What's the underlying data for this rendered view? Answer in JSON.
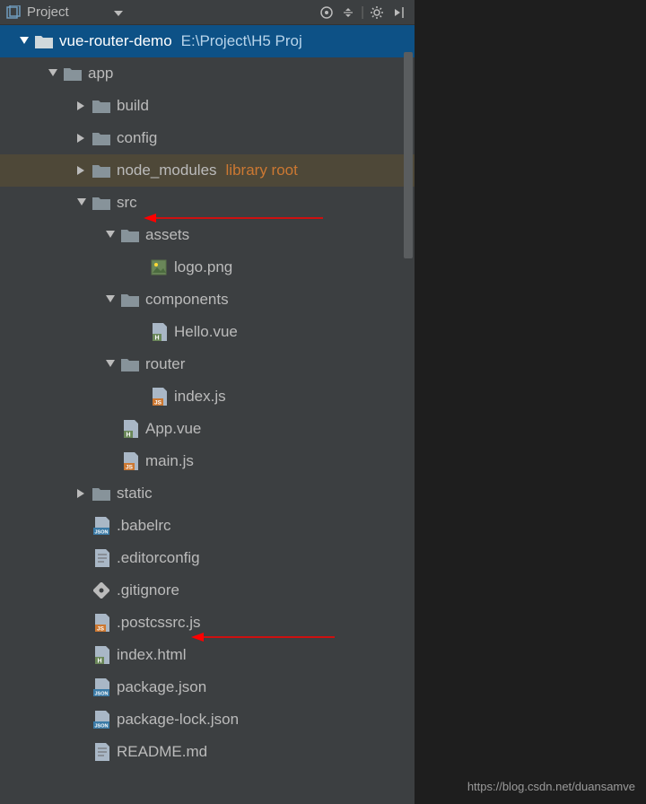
{
  "toolbar": {
    "title": "Project"
  },
  "tree": {
    "root": {
      "name": "vue-router-demo",
      "path": "E:\\Project\\H5 Proj"
    },
    "app": {
      "label": "app",
      "build": "build",
      "config": "config",
      "node_modules": {
        "label": "node_modules",
        "note": "library root"
      },
      "src": {
        "label": "src",
        "assets": {
          "label": "assets",
          "logo": "logo.png"
        },
        "components": {
          "label": "components",
          "hello": "Hello.vue"
        },
        "router": {
          "label": "router",
          "indexjs": "index.js"
        },
        "appvue": "App.vue",
        "mainjs": "main.js"
      },
      "static": "static",
      "babelrc": ".babelrc",
      "editorconfig": ".editorconfig",
      "gitignore": ".gitignore",
      "postcssrc": ".postcssrc.js",
      "indexhtml": "index.html",
      "packagejson": "package.json",
      "packagelock": "package-lock.json",
      "readme": "README.md"
    }
  },
  "watermark": "https://blog.csdn.net/duansamve"
}
